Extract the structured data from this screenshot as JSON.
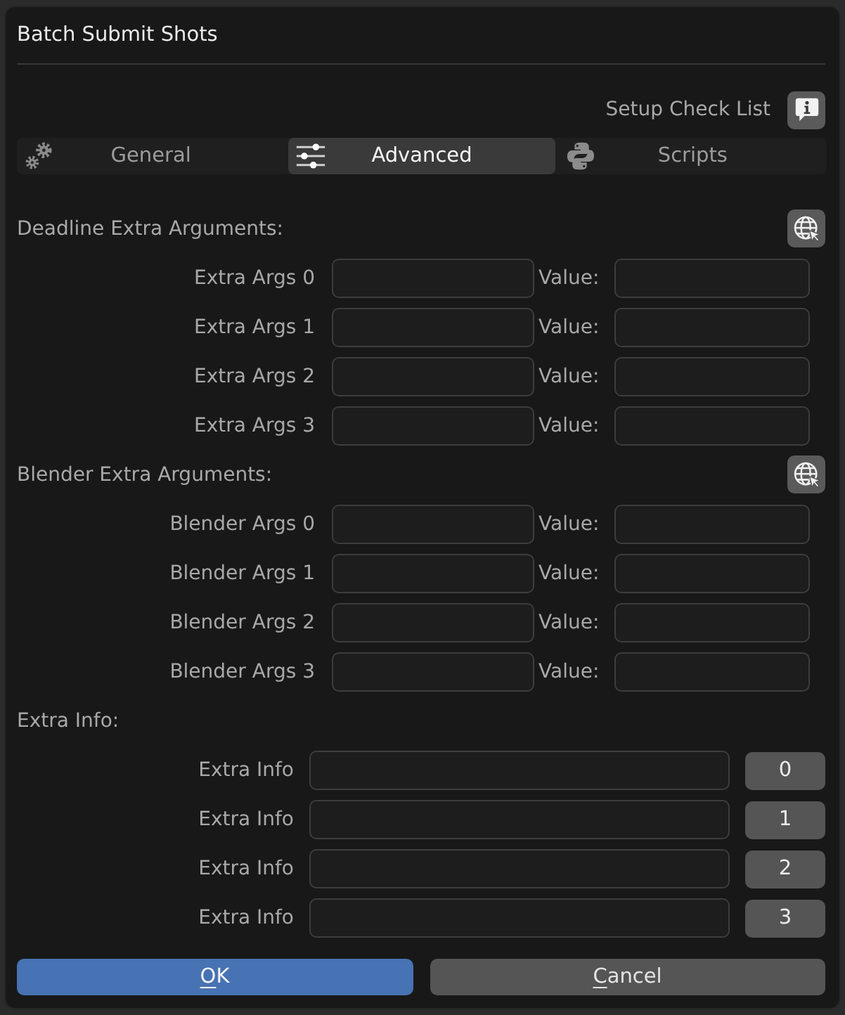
{
  "window": {
    "title": "Batch Submit Shots"
  },
  "header": {
    "setup_check_label": "Setup Check List"
  },
  "tabs": [
    {
      "label": "General",
      "selected": false
    },
    {
      "label": "Advanced",
      "selected": true
    },
    {
      "label": "Scripts",
      "selected": false
    }
  ],
  "sections": [
    {
      "title": "Deadline Extra Arguments:",
      "kind": "pairs",
      "rows": [
        {
          "label": "Extra Args 0",
          "value_label": "Value:"
        },
        {
          "label": "Extra Args 1",
          "value_label": "Value:"
        },
        {
          "label": "Extra Args 2",
          "value_label": "Value:"
        },
        {
          "label": "Extra Args 3",
          "value_label": "Value:"
        }
      ]
    },
    {
      "title": "Blender Extra Arguments:",
      "kind": "pairs",
      "rows": [
        {
          "label": "Blender Args 0",
          "value_label": "Value:"
        },
        {
          "label": "Blender Args 1",
          "value_label": "Value:"
        },
        {
          "label": "Blender Args 2",
          "value_label": "Value:"
        },
        {
          "label": "Blender Args 3",
          "value_label": "Value:"
        }
      ]
    },
    {
      "title": "Extra Info:",
      "kind": "indexed",
      "rows": [
        {
          "label": "Extra Info",
          "index": "0"
        },
        {
          "label": "Extra Info",
          "index": "1"
        },
        {
          "label": "Extra Info",
          "index": "2"
        },
        {
          "label": "Extra Info",
          "index": "3"
        }
      ]
    }
  ],
  "buttons": [
    {
      "label": "OK",
      "kind": "primary",
      "mnemonic": true
    },
    {
      "label": "Cancel",
      "kind": "secondary",
      "mnemonic": true
    }
  ]
}
